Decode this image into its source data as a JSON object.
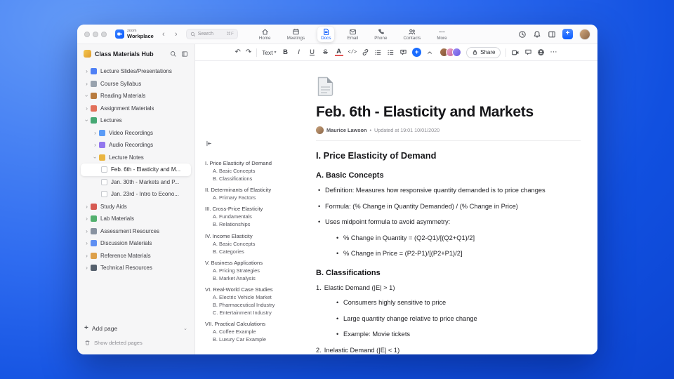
{
  "titlebar": {
    "brand": {
      "top": "zoom",
      "bottom": "Workplace"
    },
    "search": {
      "placeholder": "Search",
      "shortcut": "⌘F"
    },
    "tabs": [
      {
        "label": "Home"
      },
      {
        "label": "Meetings"
      },
      {
        "label": "Docs",
        "active": true
      },
      {
        "label": "Email"
      },
      {
        "label": "Phone"
      },
      {
        "label": "Contacts"
      },
      {
        "label": "More"
      }
    ]
  },
  "sidebar": {
    "title": "Class Materials Hub",
    "items": [
      {
        "label": "Lecture Slides/Presentations",
        "icon": "presentation-icon",
        "depth": 0,
        "state": "collapsed"
      },
      {
        "label": "Course Syllabus",
        "icon": "syllabus-icon",
        "depth": 0,
        "state": "collapsed"
      },
      {
        "label": "Reading Materials",
        "icon": "reading-icon",
        "depth": 0,
        "state": "expanded"
      },
      {
        "label": "Assignment Materials",
        "icon": "assignment-icon",
        "depth": 0,
        "state": "collapsed"
      },
      {
        "label": "Lectures",
        "icon": "lectures-icon",
        "depth": 0,
        "state": "expanded"
      },
      {
        "label": "Video Recordings",
        "icon": "video-icon",
        "depth": 1,
        "state": "collapsed"
      },
      {
        "label": "Audio Recordings",
        "icon": "audio-icon",
        "depth": 1,
        "state": "collapsed"
      },
      {
        "label": "Lecture Notes",
        "icon": "notes-icon",
        "depth": 1,
        "state": "expanded"
      },
      {
        "label": "Feb. 6th - Elasticity and M...",
        "icon": "page-icon",
        "depth": 2,
        "selected": true
      },
      {
        "label": "Jan. 30th - Markets and P...",
        "icon": "page-icon",
        "depth": 2
      },
      {
        "label": "Jan. 23rd - Intro to Econo...",
        "icon": "page-icon",
        "depth": 2
      },
      {
        "label": "Study Aids",
        "icon": "study-icon",
        "depth": 0,
        "state": "collapsed"
      },
      {
        "label": "Lab Materials",
        "icon": "lab-icon",
        "depth": 0,
        "state": "collapsed"
      },
      {
        "label": "Assessment Resources",
        "icon": "assessment-icon",
        "depth": 0,
        "state": "collapsed"
      },
      {
        "label": "Discussion Materials",
        "icon": "discussion-icon",
        "depth": 0,
        "state": "collapsed"
      },
      {
        "label": "Reference Materials",
        "icon": "reference-icon",
        "depth": 0,
        "state": "collapsed"
      },
      {
        "label": "Technical Resources",
        "icon": "technical-icon",
        "depth": 0,
        "state": "collapsed"
      }
    ],
    "footer": {
      "add_page_label": "Add page",
      "show_deleted_label": "Show deleted pages"
    }
  },
  "doc_toolbar": {
    "text_style_label": "Text",
    "bold_label": "B",
    "italic_label": "I",
    "underline_label": "U",
    "strike_label": "S",
    "color_label": "A",
    "code_label": "</>",
    "share_label": "Share"
  },
  "doc": {
    "title": "Feb. 6th - Elasticity and Markets",
    "author": "Maurice Lawson",
    "updated": "Updated at 19:01 10/01/2020",
    "outline": [
      {
        "text": "I. Price Elasticity of Demand",
        "level": 1
      },
      {
        "text": "A. Basic Concepts",
        "level": 2
      },
      {
        "text": "B. Classifications",
        "level": 2
      },
      {
        "text": "II. Determinants of Elasticity",
        "level": 1
      },
      {
        "text": "A. Primary Factors",
        "level": 2
      },
      {
        "text": "III. Cross-Price Elasticity",
        "level": 1
      },
      {
        "text": "A. Fundamentals",
        "level": 2
      },
      {
        "text": "B. Relationships",
        "level": 2
      },
      {
        "text": "IV. Income Elasticity",
        "level": 1
      },
      {
        "text": "A. Basic Concepts",
        "level": 2
      },
      {
        "text": "B. Categories",
        "level": 2
      },
      {
        "text": "V. Business Applications",
        "level": 1
      },
      {
        "text": "A. Pricing Strategies",
        "level": 2
      },
      {
        "text": "B. Market Analysis",
        "level": 2
      },
      {
        "text": "VI. Real-World Case Studies",
        "level": 1
      },
      {
        "text": "A. Electric Vehicle Market",
        "level": 2
      },
      {
        "text": "B. Pharmaceutical Industry",
        "level": 2
      },
      {
        "text": "C. Entertainment Industry",
        "level": 2
      },
      {
        "text": "VII. Practical Calculations",
        "level": 1
      },
      {
        "text": "A. Coffee Example",
        "level": 2
      },
      {
        "text": "B. Luxury Car Example",
        "level": 2
      }
    ],
    "content": {
      "h1": "I. Price Elasticity of Demand",
      "section_a": {
        "heading": "A. Basic Concepts",
        "bullets": [
          "Definition: Measures how responsive quantity demanded is to price changes",
          "Formula: (% Change in Quantity Demanded) / (% Change in Price)",
          "Uses midpoint formula to avoid asymmetry:"
        ],
        "formulas": [
          "% Change in Quantity = (Q2-Q1)/[(Q2+Q1)/2]",
          "% Change in Price = (P2-P1)/[(P2+P1)/2]"
        ]
      },
      "section_b": {
        "heading": "B. Classifications",
        "items": [
          {
            "marker": "1.",
            "text": "Elastic Demand (|E| > 1)",
            "bullets": [
              "Consumers highly sensitive to price",
              "Large quantity change relative to price change",
              "Example: Movie tickets"
            ]
          },
          {
            "marker": "2.",
            "text": "Inelastic Demand (|E| < 1)",
            "bullets": []
          }
        ]
      }
    }
  }
}
